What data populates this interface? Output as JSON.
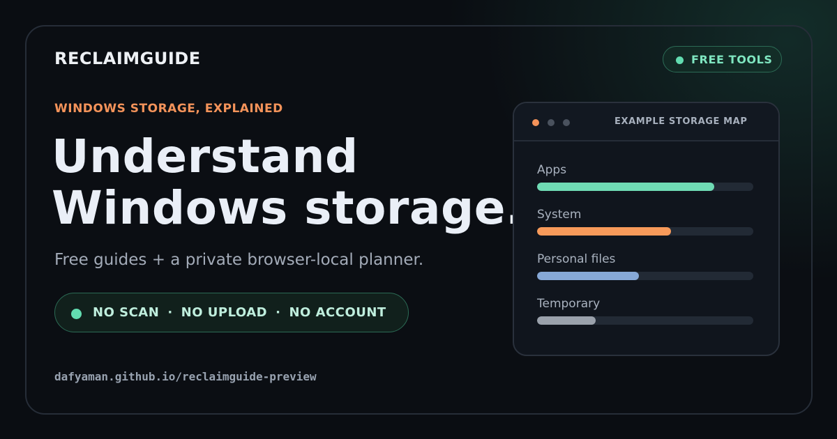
{
  "brand": "RECLAIMGUIDE",
  "badge": {
    "label": "FREE TOOLS",
    "color": "#62dcb0",
    "icon": "status-dot-icon"
  },
  "eyebrow": "WINDOWS STORAGE, EXPLAINED",
  "headline": {
    "line1": "Understand",
    "line2": "Windows storage."
  },
  "subline": "Free guides + a private browser-local planner.",
  "features": {
    "items": [
      "NO SCAN",
      "NO UPLOAD",
      "NO ACCOUNT"
    ],
    "separator": "·",
    "icon": "status-dot-icon"
  },
  "url": "dafyaman.github.io/reclaimguide-preview",
  "storage_card": {
    "title": "EXAMPLE STORAGE MAP",
    "window_dots": [
      "#f4935a",
      "#4a525e",
      "#4a525e"
    ],
    "items": [
      {
        "label": "Apps",
        "fill_fraction": 0.82,
        "color": "#6fdbb4"
      },
      {
        "label": "System",
        "fill_fraction": 0.62,
        "color": "#f79a5a"
      },
      {
        "label": "Personal files",
        "fill_fraction": 0.47,
        "color": "#86a8d6"
      },
      {
        "label": "Temporary",
        "fill_fraction": 0.27,
        "color": "#9aa1ab"
      }
    ]
  },
  "colors": {
    "accent_green": "#62dcb0",
    "accent_orange": "#f4935a",
    "background": "#0b0e13"
  }
}
